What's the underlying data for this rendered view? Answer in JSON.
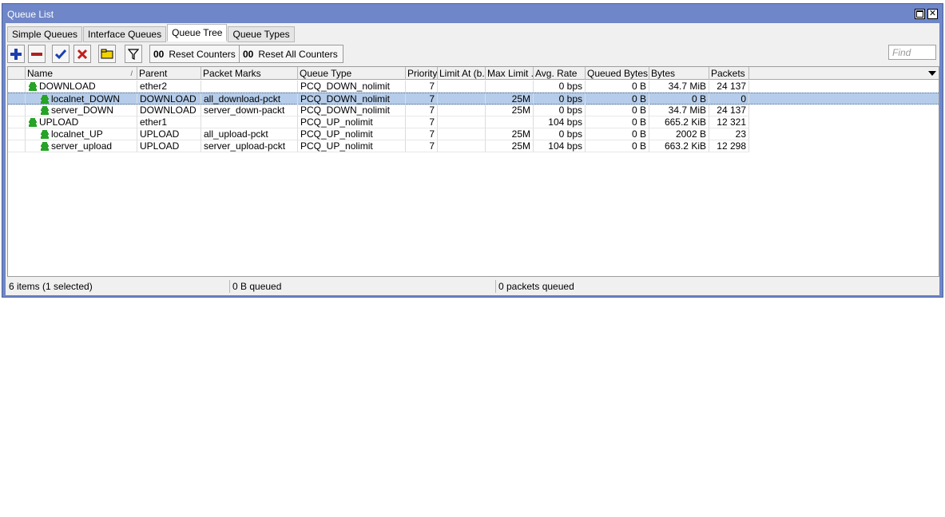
{
  "window": {
    "title": "Queue List"
  },
  "tabs": [
    {
      "label": "Simple Queues",
      "active": false
    },
    {
      "label": "Interface Queues",
      "active": false
    },
    {
      "label": "Queue Tree",
      "active": true
    },
    {
      "label": "Queue Types",
      "active": false
    }
  ],
  "toolbar": {
    "reset_counters": "Reset Counters",
    "reset_all_counters": "Reset All Counters",
    "counter_glyph": "00",
    "find_placeholder": "Find"
  },
  "table": {
    "columns": [
      "Name",
      "Parent",
      "Packet Marks",
      "Queue Type",
      "Priority",
      "Limit At (b...",
      "Max Limit ...",
      "Avg. Rate",
      "Queued Bytes",
      "Bytes",
      "Packets"
    ],
    "rows": [
      {
        "name": "DOWNLOAD",
        "level": 0,
        "parent": "ether2",
        "packet_marks": "",
        "queue_type": "PCQ_DOWN_nolimit",
        "priority": "7",
        "limit_at": "",
        "max_limit": "",
        "avg_rate": "0 bps",
        "queued_bytes": "0 B",
        "bytes": "34.7 MiB",
        "packets": "24 137",
        "selected": false
      },
      {
        "name": "localnet_DOWN",
        "level": 1,
        "parent": "DOWNLOAD",
        "packet_marks": "all_download-pckt",
        "queue_type": "PCQ_DOWN_nolimit",
        "priority": "7",
        "limit_at": "",
        "max_limit": "25M",
        "avg_rate": "0 bps",
        "queued_bytes": "0 B",
        "bytes": "0 B",
        "packets": "0",
        "selected": true
      },
      {
        "name": "server_DOWN",
        "level": 1,
        "parent": "DOWNLOAD",
        "packet_marks": "server_down-packt",
        "queue_type": "PCQ_DOWN_nolimit",
        "priority": "7",
        "limit_at": "",
        "max_limit": "25M",
        "avg_rate": "0 bps",
        "queued_bytes": "0 B",
        "bytes": "34.7 MiB",
        "packets": "24 137",
        "selected": false
      },
      {
        "name": "UPLOAD",
        "level": 0,
        "parent": "ether1",
        "packet_marks": "",
        "queue_type": "PCQ_UP_nolimit",
        "priority": "7",
        "limit_at": "",
        "max_limit": "",
        "avg_rate": "104 bps",
        "queued_bytes": "0 B",
        "bytes": "665.2 KiB",
        "packets": "12 321",
        "selected": false
      },
      {
        "name": "localnet_UP",
        "level": 1,
        "parent": "UPLOAD",
        "packet_marks": "all_upload-pckt",
        "queue_type": "PCQ_UP_nolimit",
        "priority": "7",
        "limit_at": "",
        "max_limit": "25M",
        "avg_rate": "0 bps",
        "queued_bytes": "0 B",
        "bytes": "2002 B",
        "packets": "23",
        "selected": false
      },
      {
        "name": "server_upload",
        "level": 1,
        "parent": "UPLOAD",
        "packet_marks": "server_upload-pckt",
        "queue_type": "PCQ_UP_nolimit",
        "priority": "7",
        "limit_at": "",
        "max_limit": "25M",
        "avg_rate": "104 bps",
        "queued_bytes": "0 B",
        "bytes": "663.2 KiB",
        "packets": "12 298",
        "selected": false
      }
    ]
  },
  "status": {
    "items": "6 items (1 selected)",
    "queued_bytes": "0 B queued",
    "queued_packets": "0 packets queued"
  },
  "colors": {
    "titlebar": "#6f86c8",
    "selection": "#b5cdea",
    "queue_icon": "#27a327"
  },
  "icons": {
    "queue": "queue-icon",
    "add": "plus-icon",
    "remove": "minus-icon",
    "enable": "check-icon",
    "disable": "x-icon",
    "comment": "comment-icon",
    "filter": "filter-icon"
  }
}
